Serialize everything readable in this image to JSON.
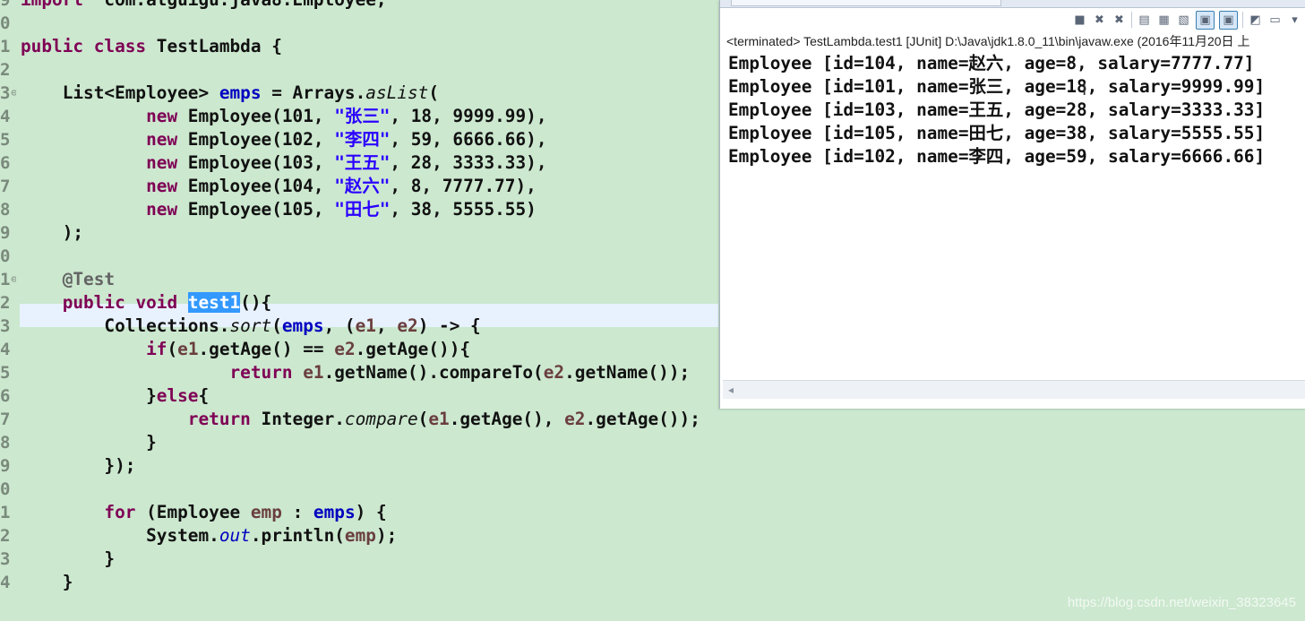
{
  "editor": {
    "lines": [
      {
        "n": "9",
        "fold": "",
        "parts": [
          [
            "kw",
            "import"
          ],
          [
            "",
            "  com.atguigu.java8.Employee;"
          ]
        ]
      },
      {
        "n": "0",
        "fold": "",
        "parts": []
      },
      {
        "n": "1",
        "fold": "",
        "parts": [
          [
            "kw",
            "public"
          ],
          [
            "",
            " "
          ],
          [
            "kw",
            "class"
          ],
          [
            "",
            " TestLambda {"
          ]
        ]
      },
      {
        "n": "2",
        "fold": "",
        "parts": []
      },
      {
        "n": "3",
        "fold": "⊖",
        "parts": [
          [
            "",
            "    List<Employee> "
          ],
          [
            "fld",
            "emps"
          ],
          [
            "",
            " = Arrays."
          ],
          [
            "it",
            "asList"
          ],
          [
            "",
            "("
          ]
        ]
      },
      {
        "n": "4",
        "fold": "",
        "parts": [
          [
            "",
            "            "
          ],
          [
            "kw",
            "new"
          ],
          [
            "",
            " Employee(101, "
          ],
          [
            "str",
            "\"张三\""
          ],
          [
            "",
            ", 18, 9999.99),"
          ]
        ]
      },
      {
        "n": "5",
        "fold": "",
        "parts": [
          [
            "",
            "            "
          ],
          [
            "kw",
            "new"
          ],
          [
            "",
            " Employee(102, "
          ],
          [
            "str",
            "\"李四\""
          ],
          [
            "",
            ", 59, 6666.66),"
          ]
        ]
      },
      {
        "n": "6",
        "fold": "",
        "parts": [
          [
            "",
            "            "
          ],
          [
            "kw",
            "new"
          ],
          [
            "",
            " Employee(103, "
          ],
          [
            "str",
            "\"王五\""
          ],
          [
            "",
            ", 28, 3333.33),"
          ]
        ]
      },
      {
        "n": "7",
        "fold": "",
        "parts": [
          [
            "",
            "            "
          ],
          [
            "kw",
            "new"
          ],
          [
            "",
            " Employee(104, "
          ],
          [
            "str",
            "\"赵六\""
          ],
          [
            "",
            ", 8, 7777.77),"
          ]
        ]
      },
      {
        "n": "8",
        "fold": "",
        "parts": [
          [
            "",
            "            "
          ],
          [
            "kw",
            "new"
          ],
          [
            "",
            " Employee(105, "
          ],
          [
            "str",
            "\"田七\""
          ],
          [
            "",
            ", 38, 5555.55)"
          ]
        ]
      },
      {
        "n": "9",
        "fold": "",
        "parts": [
          [
            "",
            "    );"
          ]
        ]
      },
      {
        "n": "0",
        "fold": "",
        "parts": []
      },
      {
        "n": "1",
        "fold": "⊖",
        "parts": [
          [
            "ann",
            "    @Test"
          ]
        ]
      },
      {
        "n": "2",
        "fold": "",
        "parts": [
          [
            "",
            "    "
          ],
          [
            "kw",
            "public"
          ],
          [
            "",
            " "
          ],
          [
            "kw",
            "void"
          ],
          [
            "",
            " "
          ],
          [
            "sel",
            "test1"
          ],
          [
            "",
            "(){"
          ]
        ]
      },
      {
        "n": "3",
        "fold": "",
        "parts": [
          [
            "",
            "        Collections."
          ],
          [
            "it",
            "sort"
          ],
          [
            "",
            "("
          ],
          [
            "fld",
            "emps"
          ],
          [
            "",
            ", ("
          ],
          [
            "var",
            "e1"
          ],
          [
            "",
            ", "
          ],
          [
            "var",
            "e2"
          ],
          [
            "",
            ") -> {"
          ]
        ]
      },
      {
        "n": "4",
        "fold": "",
        "parts": [
          [
            "",
            "            "
          ],
          [
            "kw",
            "if"
          ],
          [
            "",
            "("
          ],
          [
            "var",
            "e1"
          ],
          [
            "",
            ".getAge() == "
          ],
          [
            "var",
            "e2"
          ],
          [
            "",
            ".getAge()){"
          ]
        ]
      },
      {
        "n": "5",
        "fold": "",
        "parts": [
          [
            "",
            "                    "
          ],
          [
            "kw",
            "return"
          ],
          [
            "",
            " "
          ],
          [
            "var",
            "e1"
          ],
          [
            "",
            ".getName().compareTo("
          ],
          [
            "var",
            "e2"
          ],
          [
            "",
            ".getName());"
          ]
        ]
      },
      {
        "n": "6",
        "fold": "",
        "parts": [
          [
            "",
            "            }"
          ],
          [
            "kw",
            "else"
          ],
          [
            "",
            "{"
          ]
        ]
      },
      {
        "n": "7",
        "fold": "",
        "parts": [
          [
            "",
            "                "
          ],
          [
            "kw",
            "return"
          ],
          [
            "",
            " Integer."
          ],
          [
            "it",
            "compare"
          ],
          [
            "",
            "("
          ],
          [
            "var",
            "e1"
          ],
          [
            "",
            ".getAge(), "
          ],
          [
            "var",
            "e2"
          ],
          [
            "",
            ".getAge());"
          ]
        ]
      },
      {
        "n": "8",
        "fold": "",
        "parts": [
          [
            "",
            "            }"
          ]
        ]
      },
      {
        "n": "9",
        "fold": "",
        "parts": [
          [
            "",
            "        });"
          ]
        ]
      },
      {
        "n": "0",
        "fold": "",
        "parts": []
      },
      {
        "n": "1",
        "fold": "",
        "parts": [
          [
            "",
            "        "
          ],
          [
            "kw",
            "for"
          ],
          [
            "",
            " (Employee "
          ],
          [
            "var",
            "emp"
          ],
          [
            "",
            " : "
          ],
          [
            "fld",
            "emps"
          ],
          [
            "",
            ") {"
          ]
        ]
      },
      {
        "n": "2",
        "fold": "",
        "parts": [
          [
            "",
            "            System."
          ],
          [
            "fldit",
            "out"
          ],
          [
            "",
            ".println("
          ],
          [
            "var",
            "emp"
          ],
          [
            "",
            ");"
          ]
        ]
      },
      {
        "n": "3",
        "fold": "",
        "parts": [
          [
            "",
            "        }"
          ]
        ]
      },
      {
        "n": "4",
        "fold": "",
        "parts": [
          [
            "",
            "    }"
          ]
        ]
      }
    ]
  },
  "console": {
    "status": "<terminated> TestLambda.test1 [JUnit] D:\\Java\\jdk1.8.0_11\\bin\\javaw.exe (2016年11月20日 上",
    "output": [
      "Employee [id=104, name=赵六, age=8, salary=7777.77]",
      "Employee [id=101, name=张三, age=18, salary=9999.99]",
      "Employee [id=103, name=王五, age=28, salary=3333.33]",
      "Employee [id=105, name=田七, age=38, salary=5555.55]",
      "Employee [id=102, name=李四, age=59, salary=6666.66]"
    ],
    "toolbar": [
      {
        "name": "terminate-icon",
        "glyph": "■"
      },
      {
        "name": "remove-launch-icon",
        "glyph": "✖"
      },
      {
        "name": "remove-all-terminated-icon",
        "glyph": "✖"
      },
      {
        "name": "sep"
      },
      {
        "name": "scroll-lock-icon",
        "glyph": "▤"
      },
      {
        "name": "word-wrap-icon",
        "glyph": "▦"
      },
      {
        "name": "show-console-output-icon",
        "glyph": "▧"
      },
      {
        "name": "show-stdout-icon",
        "glyph": "▣",
        "pressed": true
      },
      {
        "name": "show-stderr-icon",
        "glyph": "▣",
        "pressed": true
      },
      {
        "name": "sep"
      },
      {
        "name": "pin-console-icon",
        "glyph": "◩"
      },
      {
        "name": "display-console-icon",
        "glyph": "▭"
      },
      {
        "name": "view-menu-icon",
        "glyph": "▾"
      }
    ],
    "scroll_arrow": "◂"
  },
  "watermark": "https://blog.csdn.net/weixin_38323645"
}
